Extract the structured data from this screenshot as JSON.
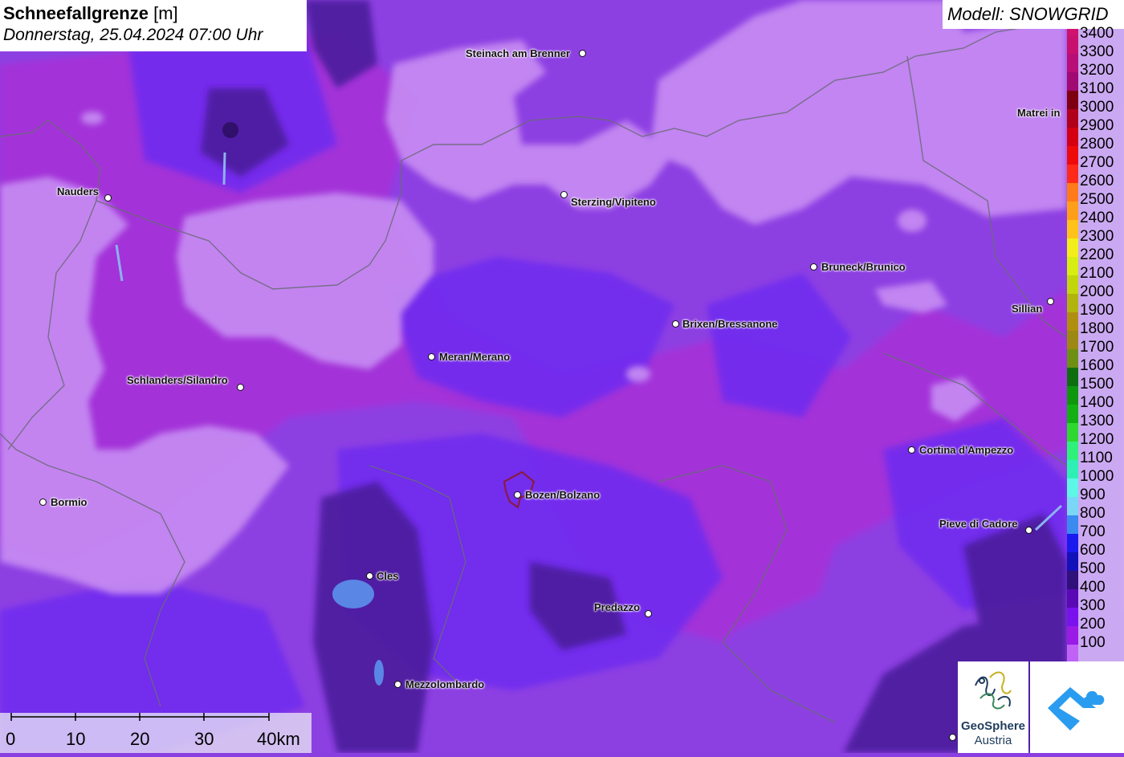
{
  "title": {
    "main": "Schneefallgrenze",
    "unit": "[m]",
    "date": "Donnerstag, 25.04.2024 07:00 Uhr"
  },
  "model": {
    "label": "Modell: SNOWGRID"
  },
  "cities": [
    {
      "name": "Steinach am Brenner"
    },
    {
      "name": "Nauders"
    },
    {
      "name": "Sterzing/Vipiteno"
    },
    {
      "name": "Matrei in"
    },
    {
      "name": "Bruneck/Brunico"
    },
    {
      "name": "Sillian"
    },
    {
      "name": "Brixen/Bressanone"
    },
    {
      "name": "Meran/Merano"
    },
    {
      "name": "Schlanders/Silandro"
    },
    {
      "name": "Cortina d'Ampezzo"
    },
    {
      "name": "Bozen/Bolzano"
    },
    {
      "name": "Bormio"
    },
    {
      "name": "Pieve di Cadore"
    },
    {
      "name": "Cles"
    },
    {
      "name": "Predazzo"
    },
    {
      "name": "Mezzolombardo"
    }
  ],
  "legend": {
    "unit": "m",
    "entries": [
      {
        "label": "3400",
        "color": "#c8106e"
      },
      {
        "label": "3300",
        "color": "#b80e78"
      },
      {
        "label": "3200",
        "color": "#a00a72"
      },
      {
        "label": "3100",
        "color": "#7e0010"
      },
      {
        "label": "3000",
        "color": "#b0001a"
      },
      {
        "label": "2900",
        "color": "#d40012"
      },
      {
        "label": "2800",
        "color": "#ee0a0a"
      },
      {
        "label": "2700",
        "color": "#ff2a1a"
      },
      {
        "label": "2600",
        "color": "#ff7a1a"
      },
      {
        "label": "2500",
        "color": "#ff9e1a"
      },
      {
        "label": "2400",
        "color": "#ffc21a"
      },
      {
        "label": "2300",
        "color": "#f2ee1a"
      },
      {
        "label": "2200",
        "color": "#d6ee12"
      },
      {
        "label": "2100",
        "color": "#c2d60e"
      },
      {
        "label": "2000",
        "color": "#b2b40e"
      },
      {
        "label": "1900",
        "color": "#b08e10"
      },
      {
        "label": "1800",
        "color": "#9c8812"
      },
      {
        "label": "1700",
        "color": "#6e9012"
      },
      {
        "label": "1600",
        "color": "#0e6e0e"
      },
      {
        "label": "1500",
        "color": "#0e960e"
      },
      {
        "label": "1400",
        "color": "#12b012"
      },
      {
        "label": "1300",
        "color": "#2ed82e"
      },
      {
        "label": "1200",
        "color": "#2ef07a"
      },
      {
        "label": "1100",
        "color": "#2ef0b4"
      },
      {
        "label": "1000",
        "color": "#5ef6e6"
      },
      {
        "label": "900",
        "color": "#7ad6f6"
      },
      {
        "label": "800",
        "color": "#3a8af0"
      },
      {
        "label": "700",
        "color": "#1a1aee"
      },
      {
        "label": "600",
        "color": "#1212b8"
      },
      {
        "label": "500",
        "color": "#30107a"
      },
      {
        "label": "400",
        "color": "#5a0ab4"
      },
      {
        "label": "300",
        "color": "#7a12ee"
      },
      {
        "label": "200",
        "color": "#9a1ae6"
      },
      {
        "label": "100",
        "color": "#c062f6"
      }
    ]
  },
  "scale_bar": {
    "labels": [
      "0",
      "10",
      "20",
      "30",
      "40km"
    ]
  },
  "logos": {
    "geosphere_line1": "GeoSphere",
    "geosphere_line2": "Austria"
  },
  "colors": {
    "base": "#8a3fe0",
    "light": "#c284f2",
    "blue": "#6a2ef4",
    "dark": "#4a1e9a",
    "magenta": "#a630dc"
  }
}
